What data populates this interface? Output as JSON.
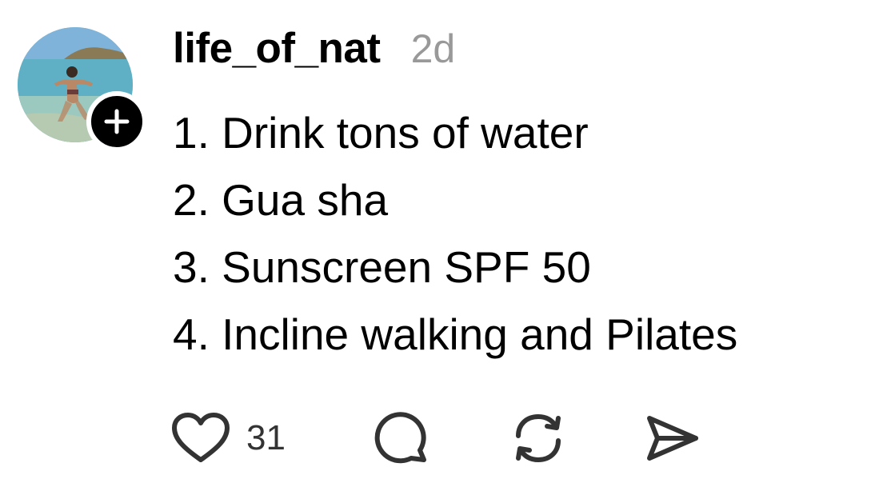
{
  "post": {
    "username": "life_of_nat",
    "timestamp": "2d",
    "lines": [
      "1. Drink tons of water",
      "2. Gua sha",
      "3. Sunscreen SPF 50",
      "4. Incline walking and Pilates"
    ],
    "like_count": "31"
  },
  "icons": {
    "avatar": "profile-photo",
    "follow": "plus-icon",
    "like": "heart-icon",
    "comment": "speech-bubble-icon",
    "repost": "repost-arrows-icon",
    "share": "paper-plane-icon"
  },
  "colors": {
    "text": "#000000",
    "muted": "#999999",
    "icon": "#333333",
    "follow_badge": "#000000"
  }
}
